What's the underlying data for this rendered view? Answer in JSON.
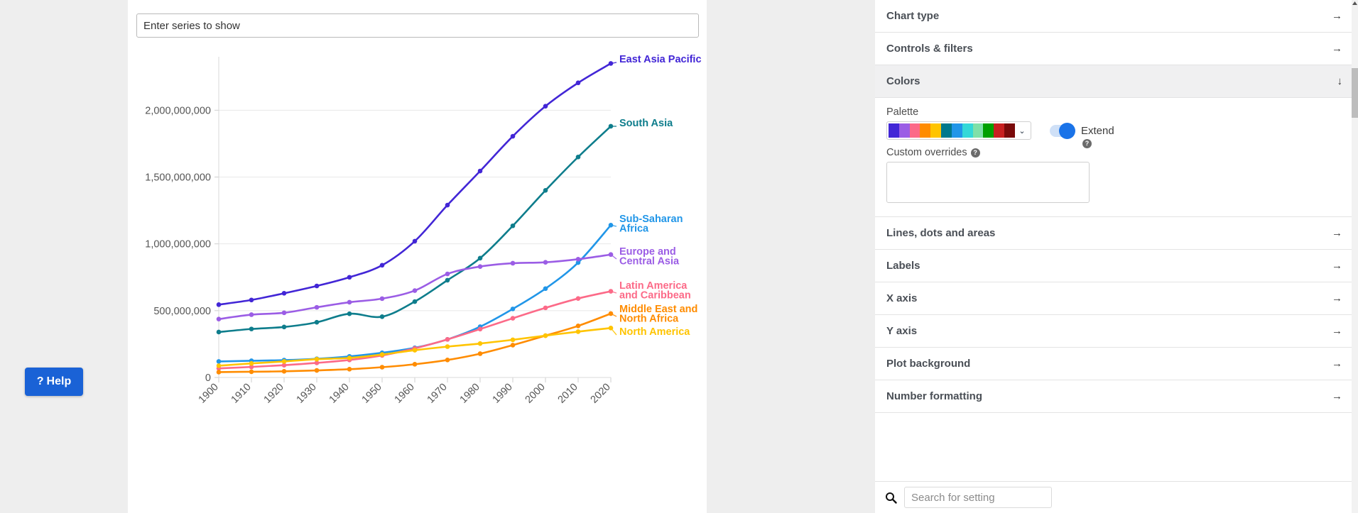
{
  "chart_panel": {
    "series_input_placeholder": "Enter series to show"
  },
  "help": {
    "label": "Help",
    "icon": "?"
  },
  "settings_panel": {
    "rows_top": [
      {
        "label": "Chart type",
        "arrow": "→"
      },
      {
        "label": "Controls & filters",
        "arrow": "→"
      }
    ],
    "colors_section": {
      "label": "Colors",
      "arrow": "↓",
      "palette_label": "Palette",
      "palette_caret": "⌄",
      "palette_colors": [
        "#4226d6",
        "#9b5de5",
        "#fc6a88",
        "#ff8c00",
        "#ffc400",
        "#00798c",
        "#2196e8",
        "#34d8d8",
        "#7fe0a8",
        "#00a000",
        "#c82020",
        "#7a0a0a"
      ],
      "extend_label": "Extend",
      "extend_on": true,
      "help_icon": "?",
      "custom_overrides_label": "Custom overrides",
      "custom_overrides_value": ""
    },
    "rows_bottom": [
      {
        "label": "Lines, dots and areas",
        "arrow": "→"
      },
      {
        "label": "Labels",
        "arrow": "→"
      },
      {
        "label": "X axis",
        "arrow": "→"
      },
      {
        "label": "Y axis",
        "arrow": "→"
      },
      {
        "label": "Plot background",
        "arrow": "→"
      },
      {
        "label": "Number formatting",
        "arrow": "→"
      }
    ],
    "search": {
      "placeholder": "Search for setting",
      "icon": "search-icon",
      "value": ""
    }
  },
  "chart_data": {
    "type": "line",
    "title": "",
    "xlabel": "",
    "ylabel": "",
    "x": [
      1900,
      1910,
      1920,
      1930,
      1940,
      1950,
      1960,
      1970,
      1980,
      1990,
      2000,
      2010,
      2020
    ],
    "xtick_labels": [
      "1900",
      "1910",
      "1920",
      "1930",
      "1940",
      "1950",
      "1960",
      "1970",
      "1980",
      "1990",
      "2000",
      "2010",
      "2020"
    ],
    "ytick_labels": [
      "0",
      "500,000,000",
      "1,000,000,000",
      "1,500,000,000",
      "2,000,000,000"
    ],
    "yticks": [
      0,
      500000000,
      1000000000,
      1500000000,
      2000000000
    ],
    "ylim": [
      0,
      2400000000
    ],
    "xlim": [
      1900,
      2020
    ],
    "grid": true,
    "legend": "inline-right-labels",
    "series": [
      {
        "name": "East Asia Pacific",
        "color": "#4226d6",
        "values": [
          545000000,
          580000000,
          630000000,
          685000000,
          750000000,
          840000000,
          1020000000,
          1290000000,
          1545000000,
          1805000000,
          2030000000,
          2205000000,
          2350000000
        ]
      },
      {
        "name": "South Asia",
        "color": "#0e7d8c",
        "values": [
          340000000,
          363000000,
          378000000,
          413000000,
          477000000,
          455000000,
          568000000,
          728000000,
          893000000,
          1135000000,
          1400000000,
          1650000000,
          1880000000
        ]
      },
      {
        "name": "Sub-Saharan Africa",
        "color": "#2196e8",
        "values": [
          120000000,
          125000000,
          130000000,
          140000000,
          158000000,
          185000000,
          222000000,
          285000000,
          380000000,
          513000000,
          665000000,
          860000000,
          1140000000
        ]
      },
      {
        "name": "Europe and Central Asia",
        "color": "#9b5de5",
        "values": [
          437000000,
          470000000,
          484000000,
          525000000,
          563000000,
          590000000,
          650000000,
          775000000,
          830000000,
          855000000,
          862000000,
          885000000,
          920000000
        ]
      },
      {
        "name": "Latin America and Caribbean",
        "color": "#fc6a88",
        "values": [
          68000000,
          79000000,
          92000000,
          109000000,
          131000000,
          165000000,
          218000000,
          285000000,
          362000000,
          443000000,
          521000000,
          591000000,
          645000000
        ]
      },
      {
        "name": "Middle East and North Africa",
        "color": "#ff8c00",
        "values": [
          40000000,
          43000000,
          46000000,
          53000000,
          62000000,
          77000000,
          99000000,
          131000000,
          178000000,
          242000000,
          313000000,
          386000000,
          478000000
        ]
      },
      {
        "name": "North America",
        "color": "#ffc400",
        "values": [
          88000000,
          105000000,
          120000000,
          137000000,
          146000000,
          172000000,
          204000000,
          231000000,
          254000000,
          282000000,
          313000000,
          343000000,
          370000000
        ]
      }
    ]
  }
}
